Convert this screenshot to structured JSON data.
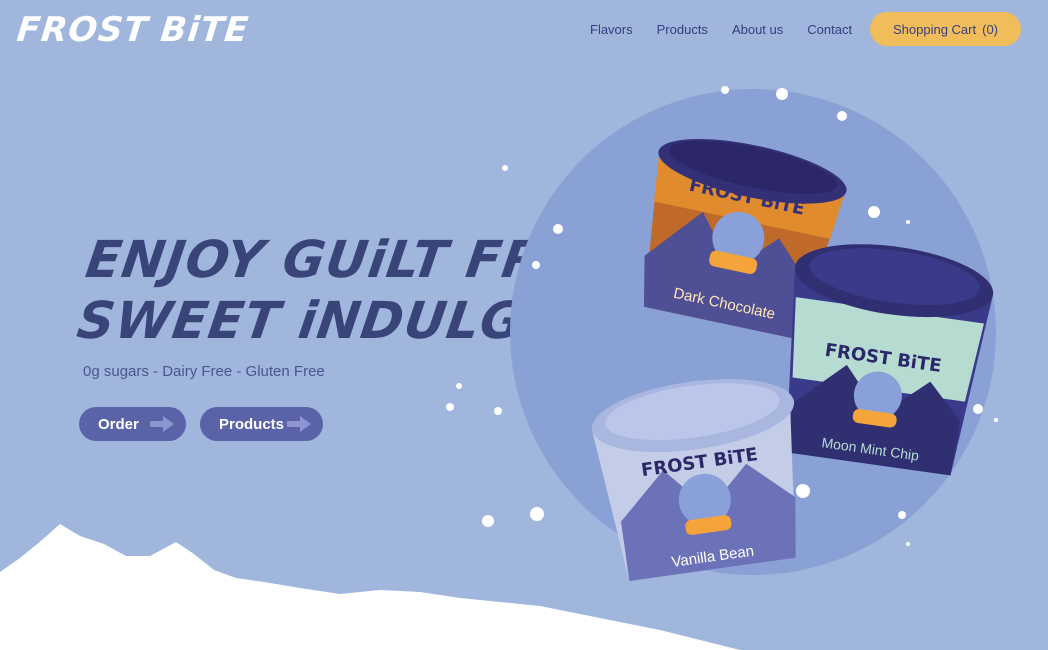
{
  "brand": {
    "logo_text": "FROST BiTE"
  },
  "nav": {
    "items": [
      "Flavors",
      "Products",
      "About us",
      "Contact"
    ],
    "cart_label": "Shopping Cart",
    "cart_count": "(0)"
  },
  "hero": {
    "headline_line1": "ENJOY GUiLT FREE",
    "headline_line2": "SWEET iNDULGENCE",
    "tagline": "0g sugars - Dairy Free - Gluten Free",
    "order_label": "Order",
    "products_label": "Products"
  },
  "products": [
    {
      "brand": "FROST BiTE",
      "flavor": "Dark Chocolate"
    },
    {
      "brand": "FROST BiTE",
      "flavor": "Moon Mint Chip"
    },
    {
      "brand": "FROST BiTE",
      "flavor": "Vanilla Bean"
    }
  ],
  "colors": {
    "background": "#a0b6dc",
    "nav_text": "#343e80",
    "cart_button": "#f1bd5a",
    "headline": "#394479",
    "buttons": "#5a63a8",
    "circle": "#8aa1d6"
  }
}
